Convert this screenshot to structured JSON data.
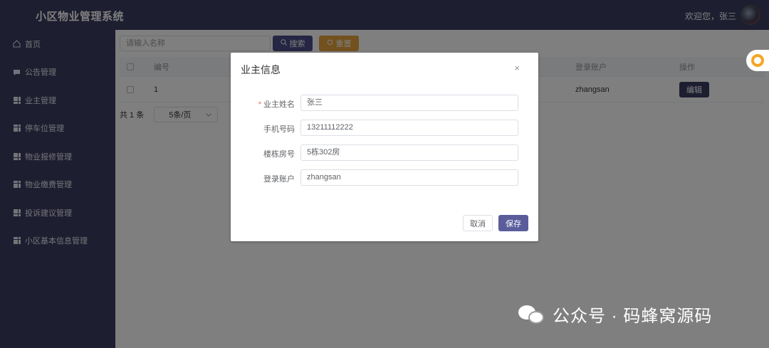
{
  "header": {
    "title": "小区物业管理系统",
    "welcome": "欢迎您，张三"
  },
  "sidebar": {
    "items": [
      {
        "label": "首页",
        "icon": "home-icon"
      },
      {
        "label": "公告管理",
        "icon": "notice-icon"
      },
      {
        "label": "业主管理",
        "icon": "grid-icon"
      },
      {
        "label": "停车位管理",
        "icon": "grid-icon"
      },
      {
        "label": "物业报修管理",
        "icon": "grid-icon"
      },
      {
        "label": "物业缴费管理",
        "icon": "grid-icon"
      },
      {
        "label": "投诉建议管理",
        "icon": "grid-icon"
      },
      {
        "label": "小区基本信息管理",
        "icon": "grid-icon"
      }
    ]
  },
  "toolbar": {
    "search_placeholder": "请输入名称",
    "search_label": "搜索",
    "reset_label": "重置"
  },
  "table": {
    "columns": [
      "编号",
      "登录账户",
      "操作"
    ],
    "rows": [
      {
        "id": "1",
        "account": "zhangsan",
        "action": "编辑"
      }
    ]
  },
  "pager": {
    "total": "共 1 条",
    "page_size": "5条/页"
  },
  "dialog": {
    "title": "业主信息",
    "close": "×",
    "fields": [
      {
        "label": "业主姓名",
        "value": "张三",
        "required": true
      },
      {
        "label": "手机号码",
        "value": "13211112222",
        "required": false
      },
      {
        "label": "楼栋房号",
        "value": "5栋302房",
        "required": false
      },
      {
        "label": "登录账户",
        "value": "zhangsan",
        "required": false
      }
    ],
    "cancel_label": "取消",
    "save_label": "保存"
  },
  "watermark": {
    "text": "公众号 · 码蜂窝源码"
  },
  "colors": {
    "sidebar_bg": "#3c3d62",
    "primary": "#4a4c86",
    "warning": "#e6a23c",
    "required": "#f56c6c"
  }
}
